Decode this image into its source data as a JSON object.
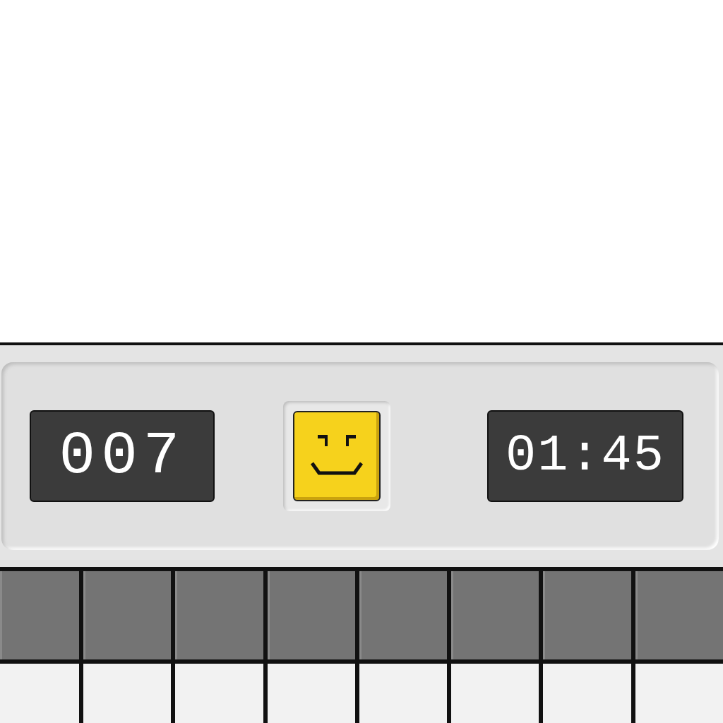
{
  "header": {
    "mine_counter": "007",
    "timer": "01:45"
  },
  "grid": {
    "rows": [
      {
        "cells": [
          {
            "revealed": false
          },
          {
            "revealed": false
          },
          {
            "revealed": false
          },
          {
            "revealed": false
          },
          {
            "revealed": false
          },
          {
            "revealed": false
          },
          {
            "revealed": false
          },
          {
            "revealed": false
          }
        ]
      },
      {
        "cells": [
          {
            "revealed": true
          },
          {
            "revealed": true
          },
          {
            "revealed": true
          },
          {
            "revealed": true
          },
          {
            "revealed": true
          },
          {
            "revealed": true
          },
          {
            "revealed": true
          },
          {
            "revealed": true
          }
        ]
      }
    ]
  }
}
